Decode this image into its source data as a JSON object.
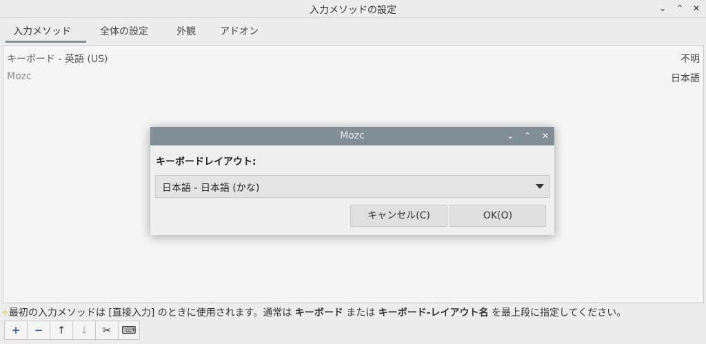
{
  "window": {
    "title": "入力メソッドの設定",
    "controls": {
      "minimize": "⌄",
      "maximize": "⌃",
      "close": "✕"
    }
  },
  "tabs": [
    {
      "label": "入力メソッド",
      "active": true
    },
    {
      "label": "全体の設定",
      "active": false
    },
    {
      "label": "外観",
      "active": false
    },
    {
      "label": "アドオン",
      "active": false
    }
  ],
  "methods": [
    {
      "name": "キーボード - 英語 (US)",
      "language": "不明"
    },
    {
      "name": "Mozc",
      "language": "日本語"
    }
  ],
  "hint": {
    "icon": "star-icon",
    "part1": "最初の入力メソッドは [直接入力] のときに使用されます。通常は ",
    "bold1": "キーボード",
    "part2": " または ",
    "bold2": "キーボード-レイアウト名",
    "part3": " を最上段に指定してください。"
  },
  "toolbar": {
    "add": "+",
    "remove": "−",
    "up": "↑",
    "down": "↓",
    "configure": "✂",
    "keyboard": "⌨"
  },
  "dialog": {
    "title": "Mozc",
    "controls": {
      "minimize": "⌄",
      "maximize": "⌃",
      "close": "✕"
    },
    "layout_label": "キーボードレイアウト:",
    "layout_value": "日本語 - 日本語 (かな)",
    "cancel_label": "キャンセル(C)",
    "ok_label": "OK(O)"
  }
}
